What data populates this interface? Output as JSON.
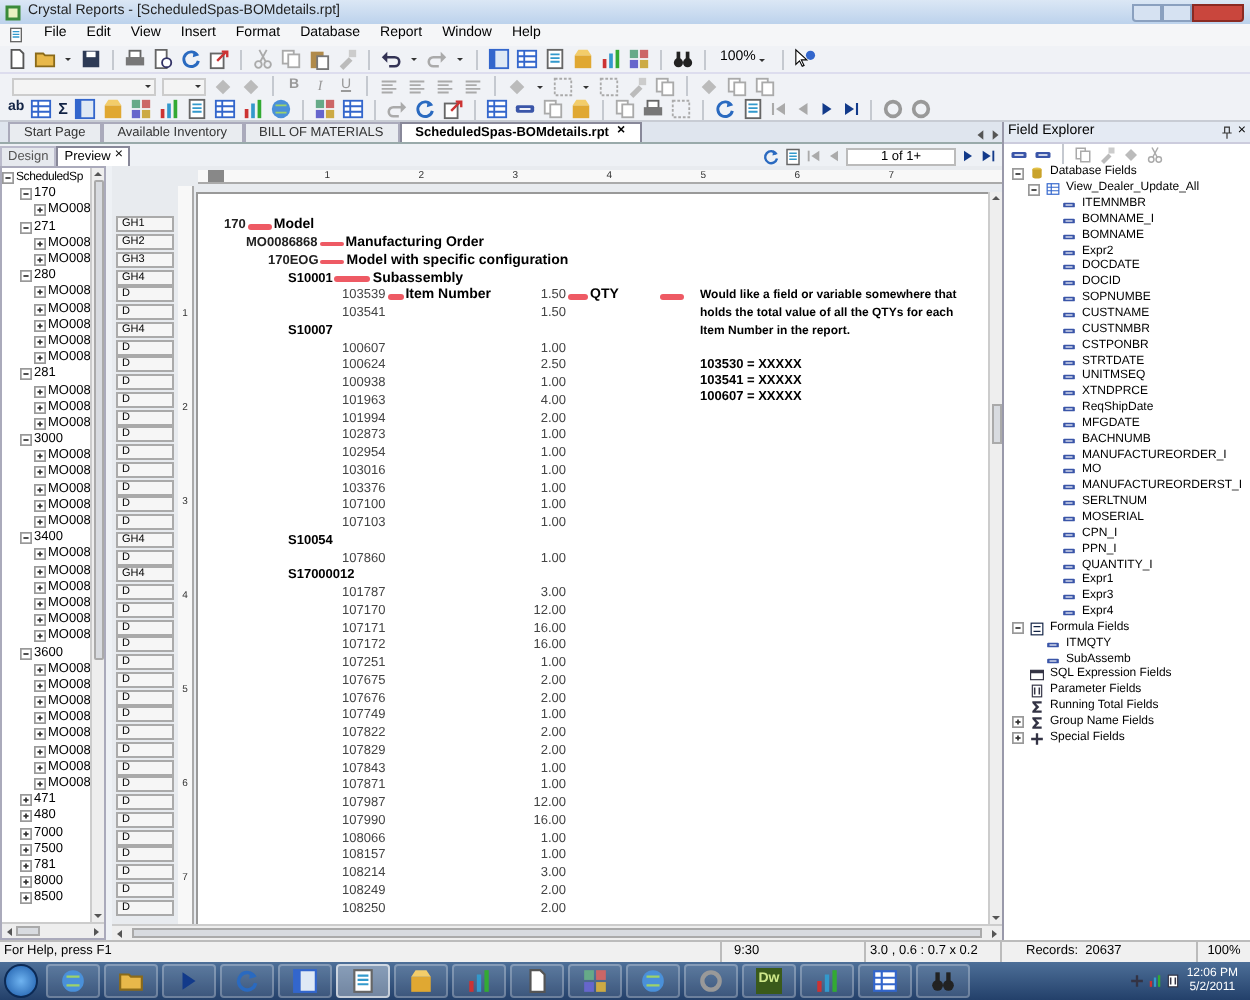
{
  "window": {
    "title": "Crystal Reports - [ScheduledSpas-BOMdetails.rpt]"
  },
  "menu": [
    "File",
    "Edit",
    "View",
    "Insert",
    "Format",
    "Database",
    "Report",
    "Window",
    "Help"
  ],
  "toolbar": {
    "zoom": "100%"
  },
  "format_toolbar": {
    "labels": [
      "B",
      "I",
      "U"
    ]
  },
  "insert_toolbar": {
    "labels": [
      "ab",
      "Σ"
    ]
  },
  "tabs": [
    {
      "label": "Start Page",
      "selected": false
    },
    {
      "label": "Available Inventory",
      "selected": false
    },
    {
      "label": "BILL OF MATERIALS",
      "selected": false
    },
    {
      "label": "ScheduledSpas-BOMdetails.rpt",
      "selected": true,
      "close": "×"
    }
  ],
  "view_tabs": [
    {
      "label": "Design",
      "selected": false
    },
    {
      "label": "Preview",
      "selected": true,
      "close": "×"
    }
  ],
  "page_nav": {
    "page": "1 of 1+"
  },
  "group_tree": {
    "root": {
      "label": "ScheduledSp",
      "expanded": true
    },
    "items": [
      {
        "label": "170",
        "expanded": true,
        "children": [
          {
            "label": "MO008",
            "expanded": false
          }
        ]
      },
      {
        "label": "271",
        "expanded": true,
        "children": [
          {
            "label": "MO008",
            "expanded": false
          },
          {
            "label": "MO008",
            "expanded": false
          }
        ]
      },
      {
        "label": "280",
        "expanded": true,
        "children": [
          {
            "label": "MO008",
            "expanded": false
          },
          {
            "label": "MO008",
            "expanded": false
          },
          {
            "label": "MO008",
            "expanded": false
          },
          {
            "label": "MO008",
            "expanded": false
          },
          {
            "label": "MO008",
            "expanded": false
          }
        ]
      },
      {
        "label": "281",
        "expanded": true,
        "children": [
          {
            "label": "MO008",
            "expanded": false
          },
          {
            "label": "MO008",
            "expanded": false
          },
          {
            "label": "MO008",
            "expanded": false
          }
        ]
      },
      {
        "label": "3000",
        "expanded": true,
        "children": [
          {
            "label": "MO008",
            "expanded": false
          },
          {
            "label": "MO008",
            "expanded": false
          },
          {
            "label": "MO008",
            "expanded": false
          },
          {
            "label": "MO008",
            "expanded": false
          },
          {
            "label": "MO008",
            "expanded": false
          }
        ]
      },
      {
        "label": "3400",
        "expanded": true,
        "children": [
          {
            "label": "MO008",
            "expanded": false
          },
          {
            "label": "MO008",
            "expanded": false
          },
          {
            "label": "MO008",
            "expanded": false
          },
          {
            "label": "MO008",
            "expanded": false
          },
          {
            "label": "MO008",
            "expanded": false
          },
          {
            "label": "MO008",
            "expanded": false
          }
        ]
      },
      {
        "label": "3600",
        "expanded": true,
        "children": [
          {
            "label": "MO008",
            "expanded": false
          },
          {
            "label": "MO008",
            "expanded": false
          },
          {
            "label": "MO008",
            "expanded": false
          },
          {
            "label": "MO008",
            "expanded": false
          },
          {
            "label": "MO008",
            "expanded": false
          },
          {
            "label": "MO008",
            "expanded": false
          },
          {
            "label": "MO008",
            "expanded": false
          },
          {
            "label": "MO008",
            "expanded": false
          }
        ]
      },
      {
        "label": "471",
        "expanded": false
      },
      {
        "label": "480",
        "expanded": false
      },
      {
        "label": "7000",
        "expanded": false
      },
      {
        "label": "7500",
        "expanded": false
      },
      {
        "label": "781",
        "expanded": false
      },
      {
        "label": "8000",
        "expanded": false
      },
      {
        "label": "8500",
        "expanded": false
      }
    ]
  },
  "ruler": {
    "marks": [
      "1",
      "2",
      "3",
      "4",
      "5",
      "6",
      "7"
    ]
  },
  "vertical_ruler": {
    "marks": [
      "1",
      "2",
      "3",
      "4",
      "5",
      "6",
      "7"
    ]
  },
  "report": {
    "rows": [
      {
        "section": "GH1",
        "kind": "model",
        "value": "170",
        "annotation": "Model"
      },
      {
        "section": "GH2",
        "kind": "order",
        "value": "MO0086868",
        "annotation": "Manufacturing Order"
      },
      {
        "section": "GH3",
        "kind": "configuration",
        "value": "170EOG",
        "annotation": "Model with specific configuration"
      },
      {
        "section": "GH4",
        "kind": "subassembly",
        "value": "S10001",
        "annotation": "Subassembly"
      },
      {
        "section": "D",
        "kind": "item",
        "value": "103539",
        "qty": "1.50",
        "annotation": "Item Number",
        "qty_annotation": "QTY"
      },
      {
        "section": "D",
        "kind": "item",
        "value": "103541",
        "qty": "1.50"
      },
      {
        "section": "GH4",
        "kind": "subassembly",
        "value": "S10007"
      },
      {
        "section": "D",
        "kind": "item",
        "value": "100607",
        "qty": "1.00"
      },
      {
        "section": "D",
        "kind": "item",
        "value": "100624",
        "qty": "2.50"
      },
      {
        "section": "D",
        "kind": "item",
        "value": "100938",
        "qty": "1.00"
      },
      {
        "section": "D",
        "kind": "item",
        "value": "101963",
        "qty": "4.00"
      },
      {
        "section": "D",
        "kind": "item",
        "value": "101994",
        "qty": "2.00"
      },
      {
        "section": "D",
        "kind": "item",
        "value": "102873",
        "qty": "1.00"
      },
      {
        "section": "D",
        "kind": "item",
        "value": "102954",
        "qty": "1.00"
      },
      {
        "section": "D",
        "kind": "item",
        "value": "103016",
        "qty": "1.00"
      },
      {
        "section": "D",
        "kind": "item",
        "value": "103376",
        "qty": "1.00"
      },
      {
        "section": "D",
        "kind": "item",
        "value": "107100",
        "qty": "1.00"
      },
      {
        "section": "D",
        "kind": "item",
        "value": "107103",
        "qty": "1.00"
      },
      {
        "section": "GH4",
        "kind": "subassembly",
        "value": "S10054"
      },
      {
        "section": "D",
        "kind": "item",
        "value": "107860",
        "qty": "1.00"
      },
      {
        "section": "GH4",
        "kind": "subassembly",
        "value": "S17000012"
      },
      {
        "section": "D",
        "kind": "item",
        "value": "101787",
        "qty": "3.00"
      },
      {
        "section": "D",
        "kind": "item",
        "value": "107170",
        "qty": "12.00"
      },
      {
        "section": "D",
        "kind": "item",
        "value": "107171",
        "qty": "16.00"
      },
      {
        "section": "D",
        "kind": "item",
        "value": "107172",
        "qty": "16.00"
      },
      {
        "section": "D",
        "kind": "item",
        "value": "107251",
        "qty": "1.00"
      },
      {
        "section": "D",
        "kind": "item",
        "value": "107675",
        "qty": "2.00"
      },
      {
        "section": "D",
        "kind": "item",
        "value": "107676",
        "qty": "2.00"
      },
      {
        "section": "D",
        "kind": "item",
        "value": "107749",
        "qty": "1.00"
      },
      {
        "section": "D",
        "kind": "item",
        "value": "107822",
        "qty": "2.00"
      },
      {
        "section": "D",
        "kind": "item",
        "value": "107829",
        "qty": "2.00"
      },
      {
        "section": "D",
        "kind": "item",
        "value": "107843",
        "qty": "1.00"
      },
      {
        "section": "D",
        "kind": "item",
        "value": "107871",
        "qty": "1.00"
      },
      {
        "section": "D",
        "kind": "item",
        "value": "107987",
        "qty": "12.00"
      },
      {
        "section": "D",
        "kind": "item",
        "value": "107990",
        "qty": "16.00"
      },
      {
        "section": "D",
        "kind": "item",
        "value": "108066",
        "qty": "1.00"
      },
      {
        "section": "D",
        "kind": "item",
        "value": "108157",
        "qty": "1.00"
      },
      {
        "section": "D",
        "kind": "item",
        "value": "108214",
        "qty": "3.00"
      },
      {
        "section": "D",
        "kind": "item",
        "value": "108249",
        "qty": "2.00"
      },
      {
        "section": "D",
        "kind": "item",
        "value": "108250",
        "qty": "2.00"
      }
    ],
    "note": {
      "text": "Would like a field or variable somewhere that holds the total value of all the QTYs for each Item Number in the report.",
      "lines": [
        "103530 = XXXXX",
        "103541 = XXXXX",
        "100607 = XXXXX"
      ]
    }
  },
  "field_explorer": {
    "title": "Field Explorer",
    "close": "×",
    "tree": [
      {
        "kind": "database",
        "label": "Database Fields",
        "expanded": true,
        "children": [
          {
            "kind": "table",
            "label": "View_Dealer_Update_All",
            "expanded": true,
            "children": [
              {
                "kind": "field",
                "label": "ITEMNMBR"
              },
              {
                "kind": "field",
                "label": "BOMNAME_I"
              },
              {
                "kind": "field",
                "label": "BOMNAME"
              },
              {
                "kind": "field",
                "label": "Expr2"
              },
              {
                "kind": "field",
                "label": "DOCDATE"
              },
              {
                "kind": "field",
                "label": "DOCID"
              },
              {
                "kind": "field",
                "label": "SOPNUMBE"
              },
              {
                "kind": "field",
                "label": "CUSTNAME"
              },
              {
                "kind": "field",
                "label": "CUSTNMBR"
              },
              {
                "kind": "field",
                "label": "CSTPONBR"
              },
              {
                "kind": "field",
                "label": "STRTDATE"
              },
              {
                "kind": "field",
                "label": "UNITMSEQ"
              },
              {
                "kind": "field",
                "label": "XTNDPRCE"
              },
              {
                "kind": "field",
                "label": "ReqShipDate"
              },
              {
                "kind": "field",
                "label": "MFGDATE"
              },
              {
                "kind": "field",
                "label": "BACHNUMB"
              },
              {
                "kind": "field",
                "label": "MANUFACTUREORDER_I"
              },
              {
                "kind": "field",
                "label": "MO"
              },
              {
                "kind": "field",
                "label": "MANUFACTUREORDERST_I"
              },
              {
                "kind": "field",
                "label": "SERLTNUM"
              },
              {
                "kind": "field",
                "label": "MOSERIAL"
              },
              {
                "kind": "field",
                "label": "CPN_I"
              },
              {
                "kind": "field",
                "label": "PPN_I"
              },
              {
                "kind": "field",
                "label": "QUANTITY_I"
              },
              {
                "kind": "field",
                "label": "Expr1"
              },
              {
                "kind": "field",
                "label": "Expr3"
              },
              {
                "kind": "field",
                "label": "Expr4"
              }
            ]
          }
        ]
      },
      {
        "kind": "formula",
        "label": "Formula Fields",
        "expanded": true,
        "children": [
          {
            "kind": "field",
            "label": "ITMQTY"
          },
          {
            "kind": "field",
            "label": "SubAssemb"
          }
        ]
      },
      {
        "kind": "sql",
        "label": "SQL Expression Fields"
      },
      {
        "kind": "parameter",
        "label": "Parameter Fields"
      },
      {
        "kind": "running_total",
        "label": "Running Total Fields"
      },
      {
        "kind": "group_name",
        "label": "Group Name Fields",
        "expanded": false
      },
      {
        "kind": "special",
        "label": "Special Fields",
        "expanded": false
      }
    ]
  },
  "status_bar": {
    "help": "For Help, press F1",
    "position": "9:30",
    "size": "3.0 , 0.6 : 0.7 x 0.2",
    "records": "Records:  20637",
    "zoom": "100%"
  },
  "taskbar": {
    "apps": [
      {
        "kind": "globe",
        "selected": false
      },
      {
        "kind": "folder",
        "selected": false
      },
      {
        "kind": "player",
        "selected": false
      },
      {
        "kind": "fox",
        "selected": false
      },
      {
        "kind": "network",
        "selected": false
      },
      {
        "kind": "window",
        "selected": true
      },
      {
        "kind": "cube",
        "selected": false
      },
      {
        "kind": "chart",
        "selected": false
      },
      {
        "kind": "note",
        "selected": false
      },
      {
        "kind": "people",
        "selected": false
      },
      {
        "kind": "skype",
        "selected": false
      },
      {
        "kind": "chrome",
        "selected": false
      },
      {
        "kind": "dw",
        "label": "Dw",
        "selected": false
      },
      {
        "kind": "redchart",
        "selected": false
      },
      {
        "kind": "sheet",
        "selected": false
      },
      {
        "kind": "camera",
        "selected": false
      }
    ],
    "clock": {
      "time": "12:06 PM",
      "date": "5/2/2011"
    }
  }
}
